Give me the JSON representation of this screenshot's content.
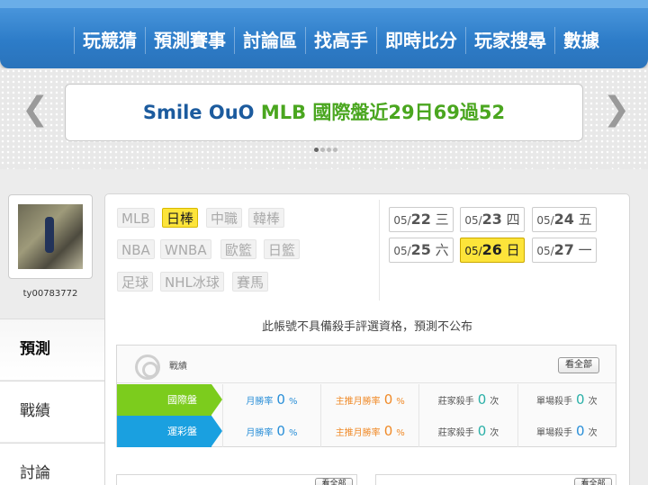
{
  "nav": {
    "items": [
      "玩競猜",
      "預測賽事",
      "討論區",
      "找高手",
      "即時比分",
      "玩家搜尋",
      "數據"
    ]
  },
  "banner": {
    "user": "Smile OuO",
    "text": " MLB 國際盤近29日69過52",
    "prev_icon": "chevron-left-icon",
    "next_icon": "chevron-right-icon"
  },
  "profile": {
    "username": "ty00783772"
  },
  "sidebar": {
    "tabs": [
      "預測",
      "戰績",
      "討論"
    ]
  },
  "leagues": {
    "items": [
      "MLB",
      "日棒",
      "中職",
      "韓棒",
      "NBA",
      "WNBA",
      "歐籃",
      "日籃",
      "足球",
      "NHL冰球",
      "賽馬"
    ],
    "selected": "日棒"
  },
  "dates": {
    "items": [
      {
        "md": "05/",
        "day": "22",
        "weekday": "三"
      },
      {
        "md": "05/",
        "day": "23",
        "weekday": "四"
      },
      {
        "md": "05/",
        "day": "24",
        "weekday": "五"
      },
      {
        "md": "05/",
        "day": "25",
        "weekday": "六"
      },
      {
        "md": "05/",
        "day": "26",
        "weekday": "日"
      },
      {
        "md": "05/",
        "day": "27",
        "weekday": "一"
      }
    ],
    "selected": "05/26"
  },
  "notice": "此帳號不具備殺手評選資格，預測不公布",
  "record": {
    "title": "戰績",
    "view_all": "看全部",
    "rows": [
      {
        "label": "國際盤",
        "cells": [
          {
            "pre": "月勝率",
            "num": "0",
            "post": "%"
          },
          {
            "pre": "主推月勝率",
            "num": "0",
            "post": "%"
          },
          {
            "pre": "莊家殺手",
            "num": "0",
            "post": "次"
          },
          {
            "pre": "單場殺手",
            "num": "0",
            "post": "次"
          }
        ]
      },
      {
        "label": "運彩盤",
        "cells": [
          {
            "pre": "月勝率",
            "num": "0",
            "post": "%"
          },
          {
            "pre": "主推月勝率",
            "num": "0",
            "post": "%"
          },
          {
            "pre": "莊家殺手",
            "num": "0",
            "post": "次"
          },
          {
            "pre": "單場殺手",
            "num": "0",
            "post": "次"
          }
        ]
      }
    ]
  },
  "bottom": {
    "left_view_all": "看全部",
    "right_view_all": "看全部"
  }
}
